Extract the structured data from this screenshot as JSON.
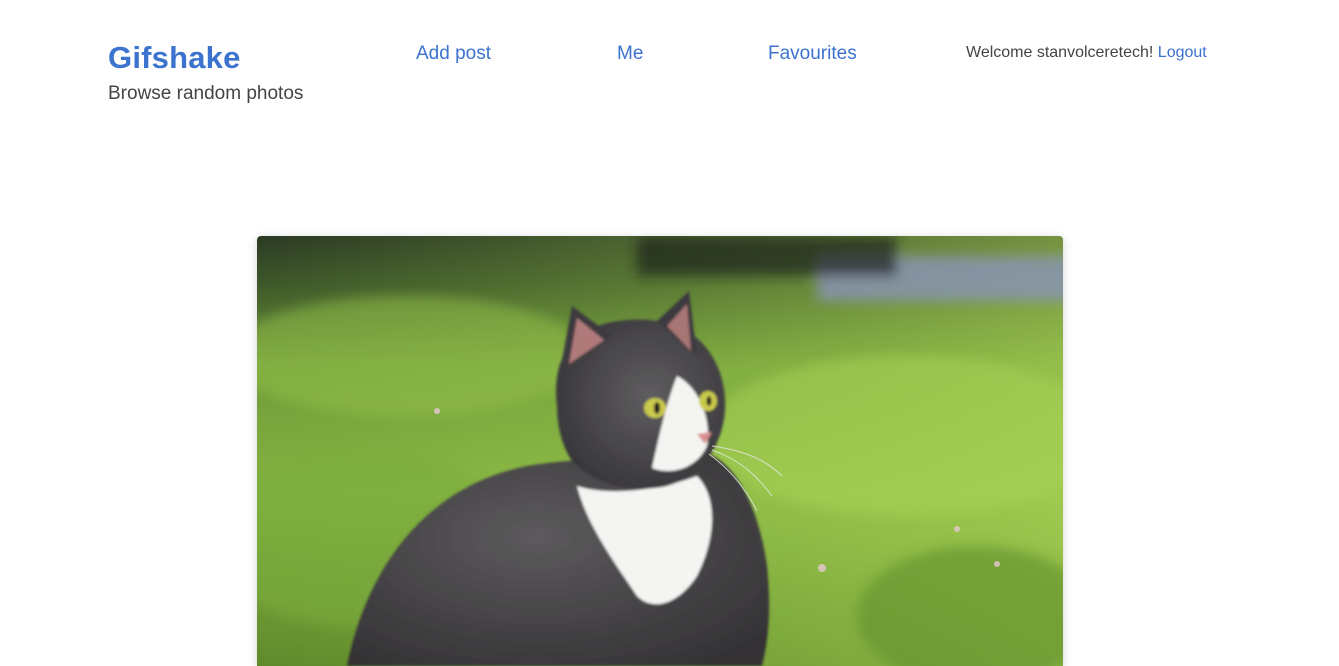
{
  "header": {
    "brand_title": "Gifshake",
    "tagline": "Browse random photos",
    "nav": {
      "add_post": "Add post",
      "me": "Me",
      "favourites": "Favourites"
    },
    "user": {
      "welcome_text": "Welcome stanvolceretech!",
      "logout_label": "Logout"
    }
  },
  "main": {
    "photo": {
      "subject": "grey-and-white cat sitting on grass"
    }
  },
  "colors": {
    "link": "#3b73cf",
    "text": "#444444",
    "background": "#ffffff"
  }
}
